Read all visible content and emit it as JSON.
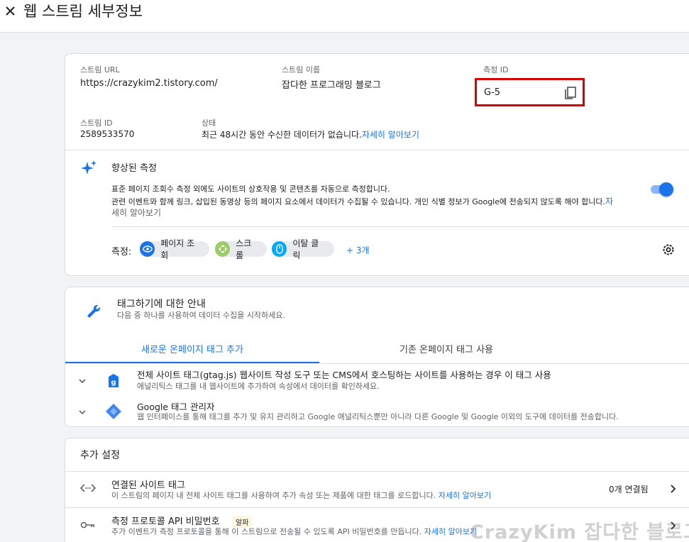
{
  "header": {
    "title": "웹 스트림 세부정보"
  },
  "stream": {
    "url_label": "스트림 URL",
    "url_value": "https://crazykim2.tistory.com/",
    "name_label": "스트림 이름",
    "name_value": "잡다한 프로그래밍 블로그",
    "mid_label": "측정 ID",
    "mid_value": "G-5",
    "id_label": "스트림 ID",
    "id_value": "2589533570",
    "status_label": "상태",
    "status_value": "최근 48시간 동안 수신한 데이터가 없습니다.",
    "status_link": "자세히 알아보기"
  },
  "enhanced": {
    "title": "향상된 측정",
    "desc1": "표준 페이지 조회수 측정 외에도 사이트의 상호작용 및 콘텐츠를 자동으로 측정합니다.",
    "desc2": "관련 이벤트와 함께 링크, 삽입된 동영상 등의 페이지 요소에서 데이터가 수집될 수 있습니다. 개인 식별 정보가 Google에 전송되지 않도록 해야 합니다.",
    "desc2_link_a": "자",
    "desc2_link_b": "세히 알아보기",
    "measure_label": "측정:",
    "chips": [
      "페이지 조회",
      "스크롤",
      "이탈 클릭"
    ],
    "more": "+ 3개",
    "toggle_on": true
  },
  "tagging": {
    "title": "태그하기에 대한 안내",
    "subtitle": "다음 중 하나를 사용하여 데이터 수집을 시작하세요.",
    "tabs": [
      "새로운 온페이지 태그 추가",
      "기존 온페이지 태그 사용"
    ],
    "rows": [
      {
        "title": "전체 사이트 태그(gtag.js) 웹사이트 작성 도구 또는 CMS에서 호스팅하는 사이트를 사용하는 경우 이 태그 사용",
        "sub": "애널리틱스 태그를 내 웹사이트에 추가하여 속성에서 데이터를 확인하세요."
      },
      {
        "title": "Google 태그 관리자",
        "sub": "웹 인터페이스를 통해 태그를 추가 및 유지 관리하고 Google 애널리틱스뿐만 아니라 다른 Google 및 Google 이외의 도구에 데이터를 전송합니다."
      }
    ]
  },
  "additional": {
    "title": "추가 설정",
    "rows": [
      {
        "title": "연결된 사이트 태그",
        "sub": "이 스트림의 페이지 내 전체 사이트 태그를 사용하여 추가 속성 또는 제품에 대한 태그를 로드합니다.",
        "link": "자세히 알아보기",
        "right": "0개 연결됨"
      },
      {
        "title": "측정 프로토콜 API 비밀번호",
        "badge": "알파",
        "sub": "추가 이벤트가 측정 프로토콜을 통해 이 스트림으로 전송될 수 있도록 API 비밀번호를 만듭니다.",
        "link": "자세히 알아보기"
      }
    ]
  },
  "watermark": "CrazyKim 잡다한 블로그",
  "colors": {
    "accent": "#1a73e8",
    "highlight_border": "#d50000"
  }
}
